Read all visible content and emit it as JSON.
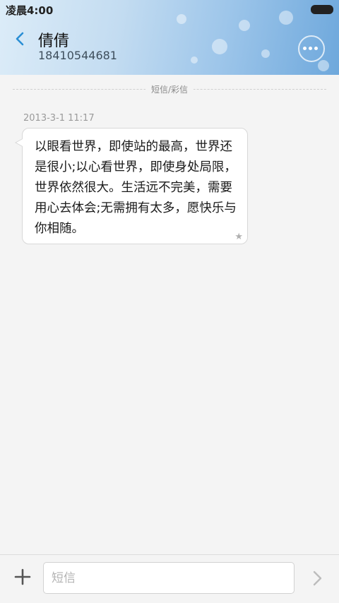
{
  "status_bar": {
    "time": "凌晨4:00"
  },
  "header": {
    "back_icon": "back-chevron-icon",
    "contact_name": "倩倩",
    "contact_number": "18410544681",
    "more_icon": "more-dots-icon"
  },
  "separator": {
    "label": "短信/彩信"
  },
  "messages": [
    {
      "timestamp": "2013-3-1 11:17",
      "text": "以眼看世界，即使站的最高，世界还是很小;以心看世界，即使身处局限，世界依然很大。生活远不完美，需要用心去体会;无需拥有太多，愿快乐与你相随。",
      "star_icon": "star-icon"
    }
  ],
  "composer": {
    "add_icon": "plus-icon",
    "placeholder": "短信",
    "send_icon": "chevron-right-icon"
  },
  "colors": {
    "accent": "#2a8fd4",
    "bubble_border": "#d8d8d8"
  }
}
